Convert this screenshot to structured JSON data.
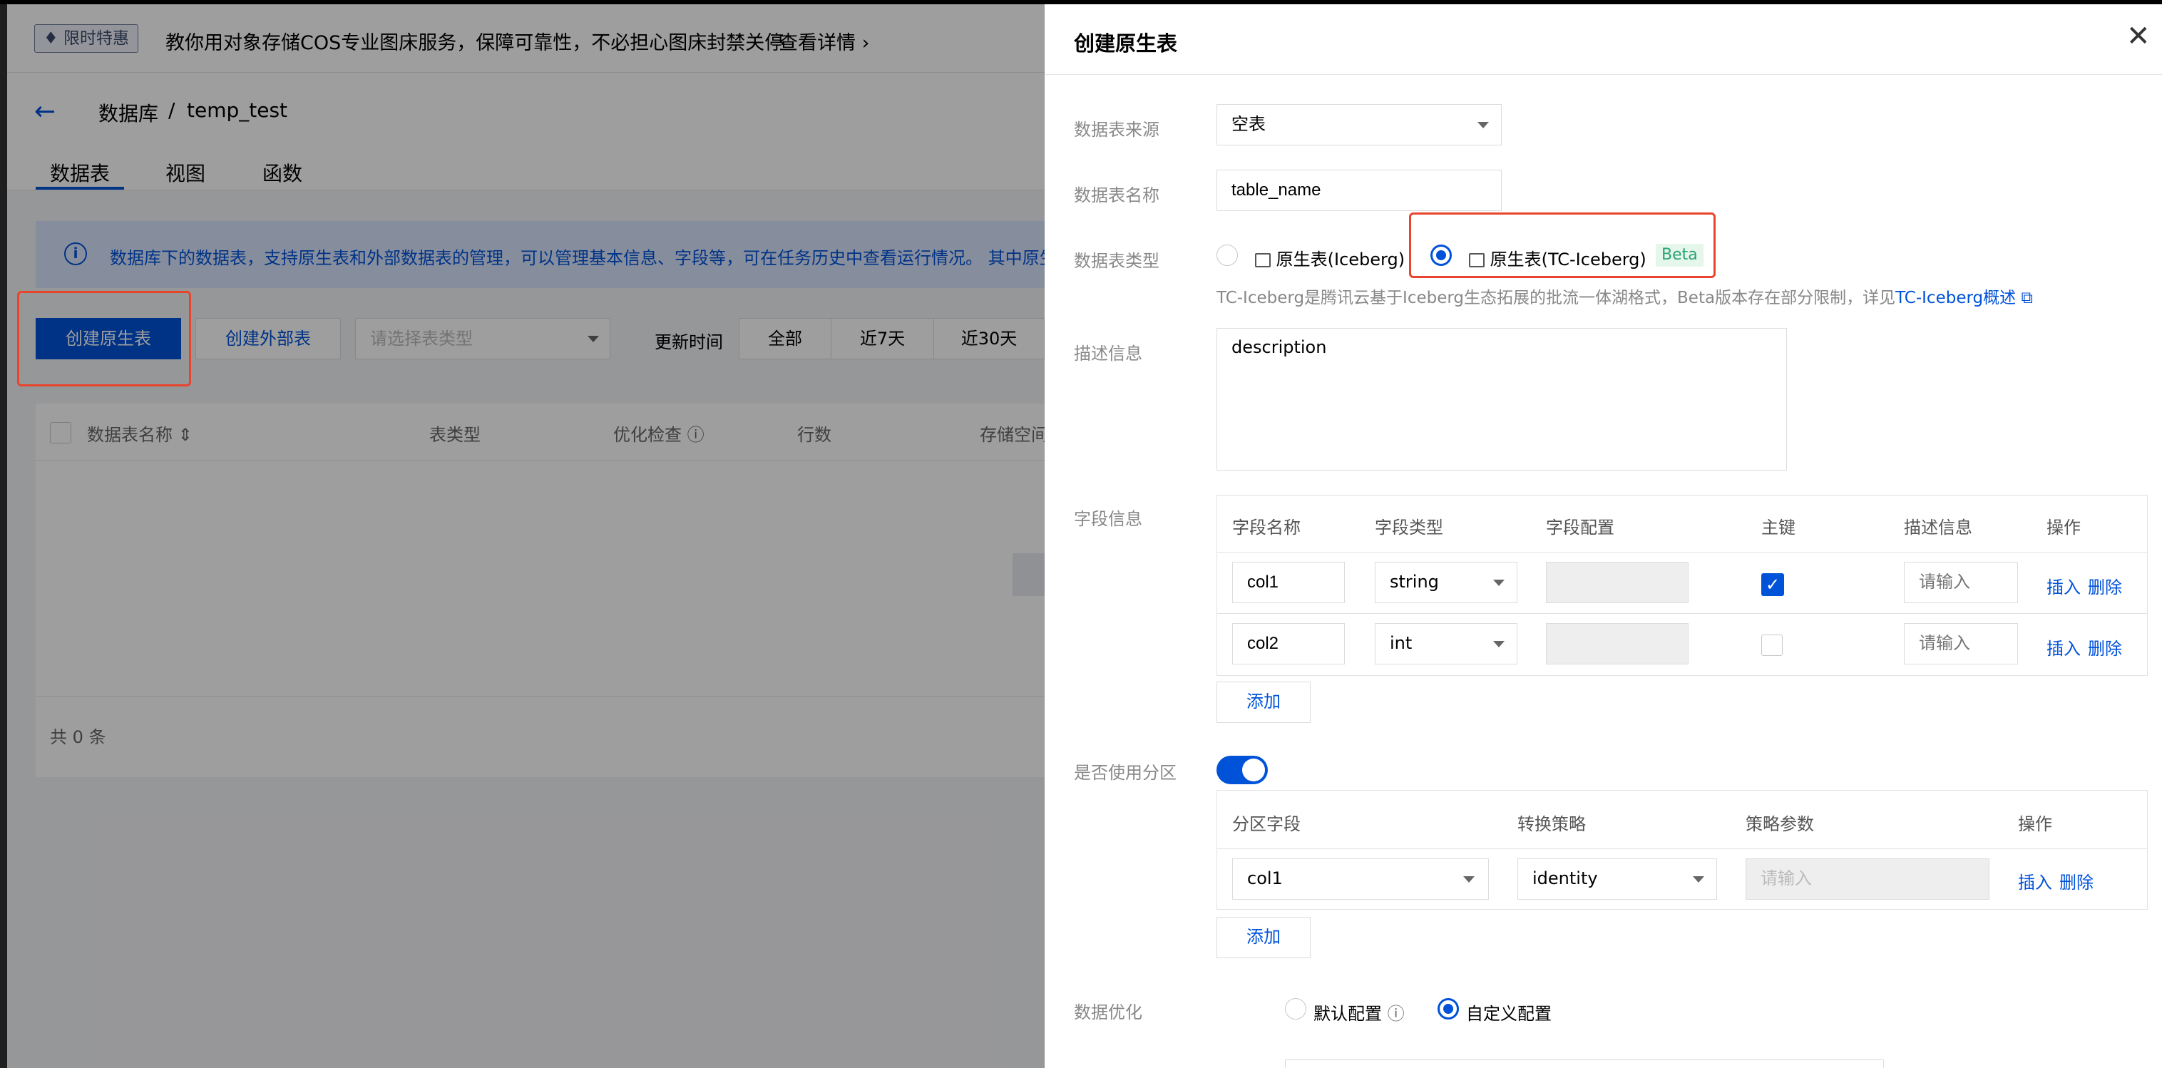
{
  "background": {
    "promo": {
      "tag": "限时特惠",
      "text": "教你用对象存储COS专业图床服务，保障可靠性，不必担心图床封禁关停",
      "link": "查看详情 ›"
    },
    "breadcrumb": {
      "database": "数据库",
      "separator": "/",
      "name": "temp_test"
    },
    "tabs": [
      "数据表",
      "视图",
      "函数"
    ],
    "info_text": "数据库下的数据表，支持原生表和外部数据表的管理，可以管理基本信息、字段等，可在任务历史中查看运行情况。 其中原生",
    "toolbar": {
      "create_native": "创建原生表",
      "create_external": "创建外部表",
      "type_placeholder": "请选择表类型",
      "update_time_label": "更新时间",
      "time_segments": [
        "全部",
        "近7天",
        "近30天"
      ]
    },
    "table": {
      "columns": [
        "数据表名称",
        "表类型",
        "优化检查",
        "行数",
        "存储空间"
      ],
      "total": "共  0  条"
    }
  },
  "drawer": {
    "title": "创建原生表",
    "close": "✕",
    "fields": {
      "source_label": "数据表来源",
      "source_value": "空表",
      "name_label": "数据表名称",
      "name_value": "table_name",
      "type_label": "数据表类型",
      "type_option_1": "原生表(Iceberg)",
      "type_option_2": "原生表(TC-Iceberg)",
      "beta": "Beta",
      "hint": "TC-Iceberg是腾讯云基于Iceberg生态拓展的批流一体湖格式，Beta版本存在部分限制，详见",
      "hint_link": "TC-Iceberg概述",
      "desc_label": "描述信息",
      "desc_value": "description",
      "columns_label": "字段信息",
      "partition_label": "是否使用分区",
      "optimize_label": "数据优化",
      "optimize_default": "默认配置",
      "optimize_custom": "自定义配置"
    },
    "columns_table": {
      "headers": [
        "字段名称",
        "字段类型",
        "字段配置",
        "主键",
        "描述信息",
        "操作"
      ],
      "rows": [
        {
          "name": "col1",
          "type": "string",
          "primary": true,
          "desc_placeholder": "请输入",
          "insert": "插入",
          "delete": "删除"
        },
        {
          "name": "col2",
          "type": "int",
          "primary": false,
          "desc_placeholder": "请输入",
          "insert": "插入",
          "delete": "删除"
        }
      ],
      "add": "添加"
    },
    "partition_table": {
      "headers": [
        "分区字段",
        "转换策略",
        "策略参数",
        "操作"
      ],
      "rows": [
        {
          "field": "col1",
          "strategy": "identity",
          "param_placeholder": "请输入",
          "insert": "插入",
          "delete": "删除"
        }
      ],
      "add": "添加"
    }
  },
  "colors": {
    "primary": "#0052d9",
    "highlight": "#e8452c",
    "beta": "#2ba471"
  }
}
